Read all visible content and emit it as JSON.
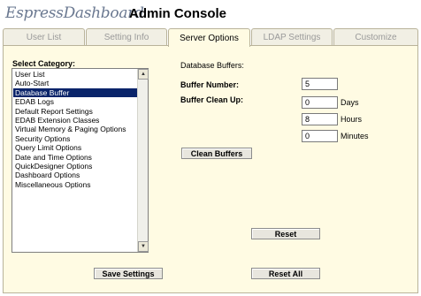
{
  "header": {
    "logo_text_1": "Espress",
    "logo_text_2": "Dashboard",
    "title": "Admin Console"
  },
  "tabs": [
    {
      "label": "User List",
      "active": false
    },
    {
      "label": "Setting Info",
      "active": false
    },
    {
      "label": "Server Options",
      "active": true
    },
    {
      "label": "LDAP Settings",
      "active": false
    },
    {
      "label": "Customize",
      "active": false
    }
  ],
  "category": {
    "label": "Select Category:",
    "items": [
      "User List",
      "Auto-Start",
      "Database Buffer",
      "EDAB Logs",
      "Default Report Settings",
      "EDAB Extension Classes",
      "Virtual Memory & Paging Options",
      "Security Options",
      "Query Limit Options",
      "Date and Time Options",
      "QuickDesigner Options",
      "Dashboard Options",
      "Miscellaneous Options"
    ],
    "selected": "Database Buffer"
  },
  "database_buffers": {
    "section_label": "Database Buffers:",
    "buffer_number_label": "Buffer Number:",
    "buffer_number_value": "5",
    "buffer_cleanup_label": "Buffer Clean Up:",
    "days_value": "0",
    "days_unit": "Days",
    "hours_value": "8",
    "hours_unit": "Hours",
    "minutes_value": "0",
    "minutes_unit": "Minutes",
    "clean_buffers_label": "Clean Buffers"
  },
  "footer": {
    "reset_label": "Reset",
    "save_settings_label": "Save Settings",
    "reset_all_label": "Reset All"
  }
}
